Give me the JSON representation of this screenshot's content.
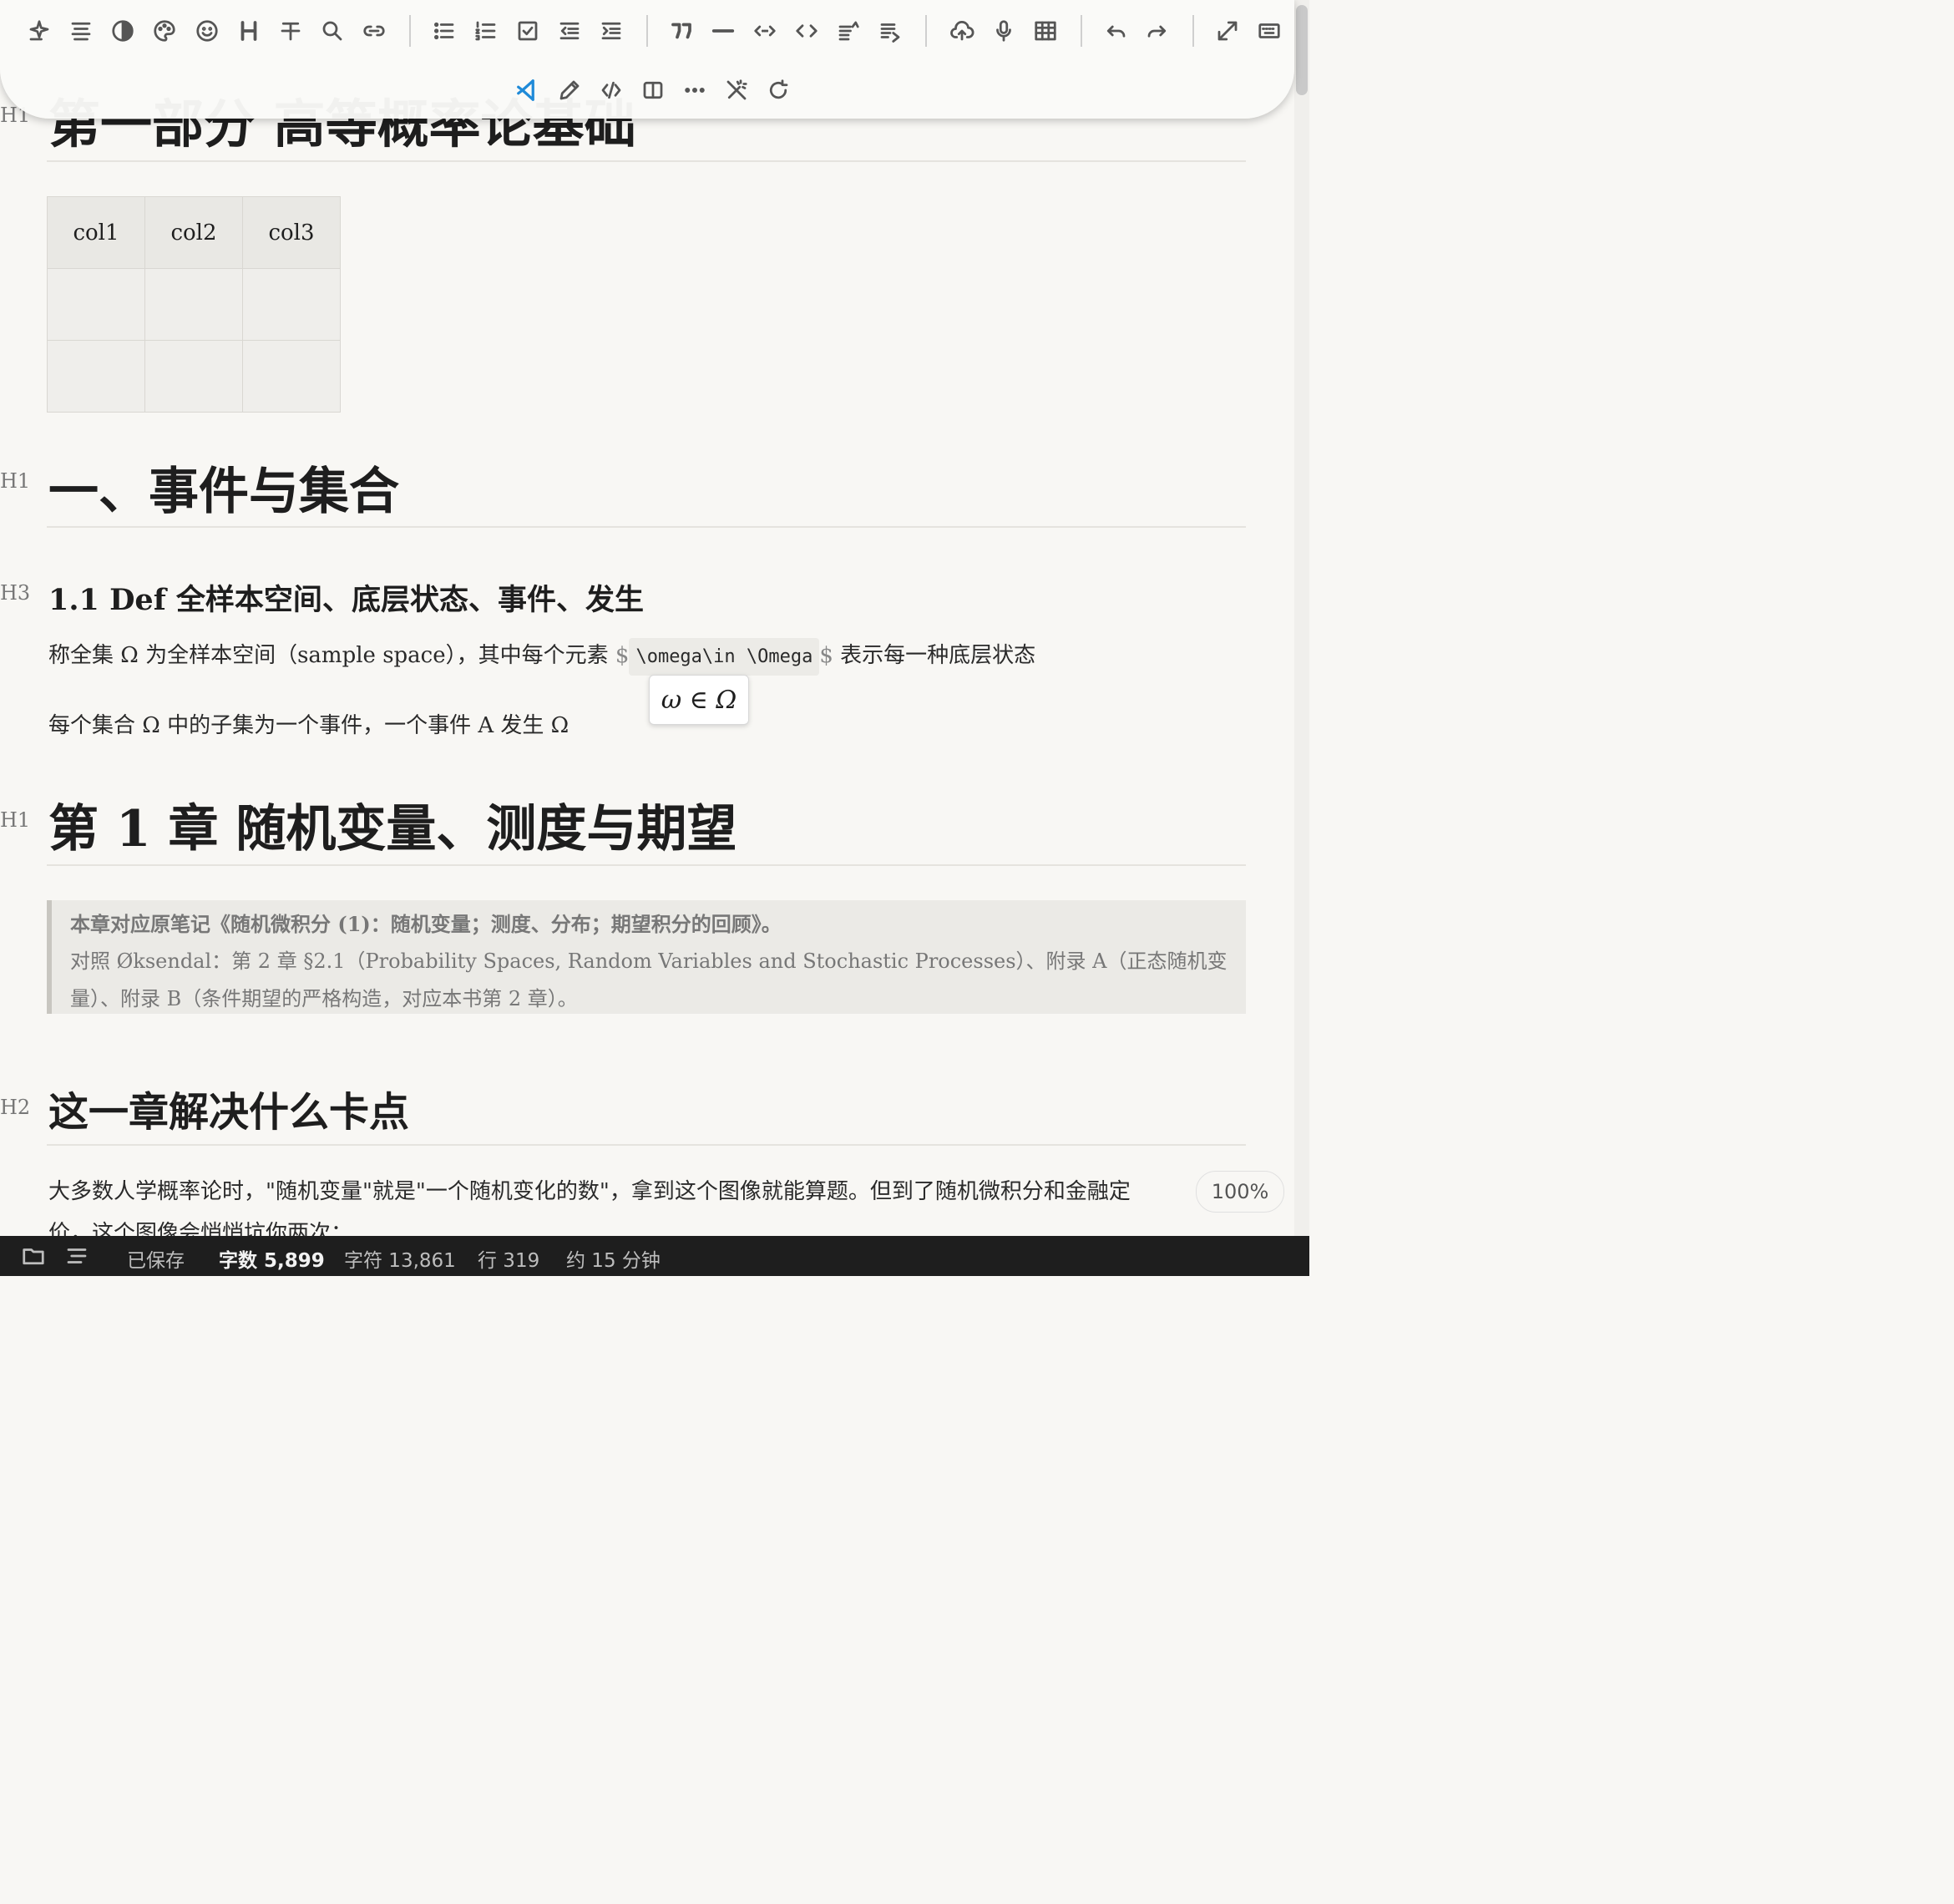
{
  "toolbar": {
    "buttons": [
      {
        "name": "ai-sparkle",
        "icon": "sparkle-icon"
      },
      {
        "name": "align",
        "icon": "align-icon"
      },
      {
        "name": "theme",
        "icon": "contrast-icon"
      },
      {
        "name": "color",
        "icon": "palette-icon"
      },
      {
        "name": "emoji",
        "icon": "emoji-icon"
      },
      {
        "name": "heading",
        "icon": "heading-icon",
        "glyph": "H"
      },
      {
        "name": "strike",
        "icon": "strikethrough-icon"
      },
      {
        "name": "search",
        "icon": "search-icon"
      },
      {
        "name": "link",
        "icon": "link-icon"
      },
      {
        "name": "bullet-list",
        "icon": "bullet-list-icon"
      },
      {
        "name": "ordered-list",
        "icon": "ordered-list-icon"
      },
      {
        "name": "check-list",
        "icon": "checkbox-icon"
      },
      {
        "name": "outdent",
        "icon": "outdent-icon"
      },
      {
        "name": "indent",
        "icon": "indent-icon"
      },
      {
        "name": "quote",
        "icon": "quote-icon",
        "glyph": "❞"
      },
      {
        "name": "horizontal-rule",
        "icon": "hr-icon"
      },
      {
        "name": "inline-code",
        "icon": "inline-code-icon"
      },
      {
        "name": "code-block",
        "icon": "code-icon"
      },
      {
        "name": "task-up",
        "icon": "list-up-icon"
      },
      {
        "name": "task-down",
        "icon": "list-down-icon"
      },
      {
        "name": "upload",
        "icon": "cloud-upload-icon"
      },
      {
        "name": "record",
        "icon": "mic-icon"
      },
      {
        "name": "table",
        "icon": "table-icon"
      },
      {
        "name": "undo",
        "icon": "undo-icon"
      },
      {
        "name": "redo",
        "icon": "redo-icon"
      },
      {
        "name": "fullscreen",
        "icon": "expand-icon"
      },
      {
        "name": "keyboard",
        "icon": "keyboard-icon"
      },
      {
        "name": "vscode",
        "icon": "vscode-icon"
      },
      {
        "name": "edit",
        "icon": "pencil-icon"
      },
      {
        "name": "source",
        "icon": "source-icon"
      },
      {
        "name": "preview",
        "icon": "book-icon"
      },
      {
        "name": "more",
        "icon": "more-icon"
      },
      {
        "name": "magic-off",
        "icon": "wand-off-icon"
      },
      {
        "name": "refresh",
        "icon": "refresh-icon"
      }
    ]
  },
  "document": {
    "h1_part": "第一部分 高等概率论基础",
    "table": {
      "headers": [
        "col1",
        "col2",
        "col3"
      ],
      "rows": [
        [
          "",
          "",
          ""
        ],
        [
          "",
          "",
          ""
        ]
      ]
    },
    "h1_events": "一、事件与集合",
    "h3_def": "1.1 Def 全样本空间、底层状态、事件、发生",
    "p1_before": "称全集 Ω 为全样本空间（sample space），其中每个元素 ",
    "p1_code": "\\omega\\in \\Omega",
    "p1_after": " 表示每一种底层状态",
    "dollar": "$",
    "math_preview": "ω ∈ Ω",
    "p2": "每个集合 Ω 中的子集为一个事件，一个事件 A 发生 Ω",
    "h1_chapter": "第 1 章 随机变量、测度与期望",
    "quote_line1": "本章对应原笔记《随机微积分 (1)：随机变量；测度、分布；期望积分的回顾》。",
    "quote_line2": "对照 Øksendal：第 2 章 §2.1（Probability Spaces, Random Variables and Stochastic Processes）、附录 A（正态随机变",
    "quote_line3": "量）、附录 B（条件期望的严格构造，对应本书第 2 章）。",
    "h2_stuck": "这一章解决什么卡点",
    "p3_line1": "大多数人学概率论时，\"随机变量\"就是\"一个随机变化的数\"，拿到这个图像就能算题。但到了随机微积分和金融定",
    "p3_line2": "价，这个图像会悄悄坑你两次：",
    "heading_marks": {
      "h1": "H1",
      "h2": "H2",
      "h3": "H3"
    }
  },
  "zoom": "100%",
  "status": {
    "saved": "已保存",
    "words": "字数 5,899",
    "chars": "字符 13,861",
    "lines": "行 319",
    "read_time": "约 15 分钟"
  }
}
